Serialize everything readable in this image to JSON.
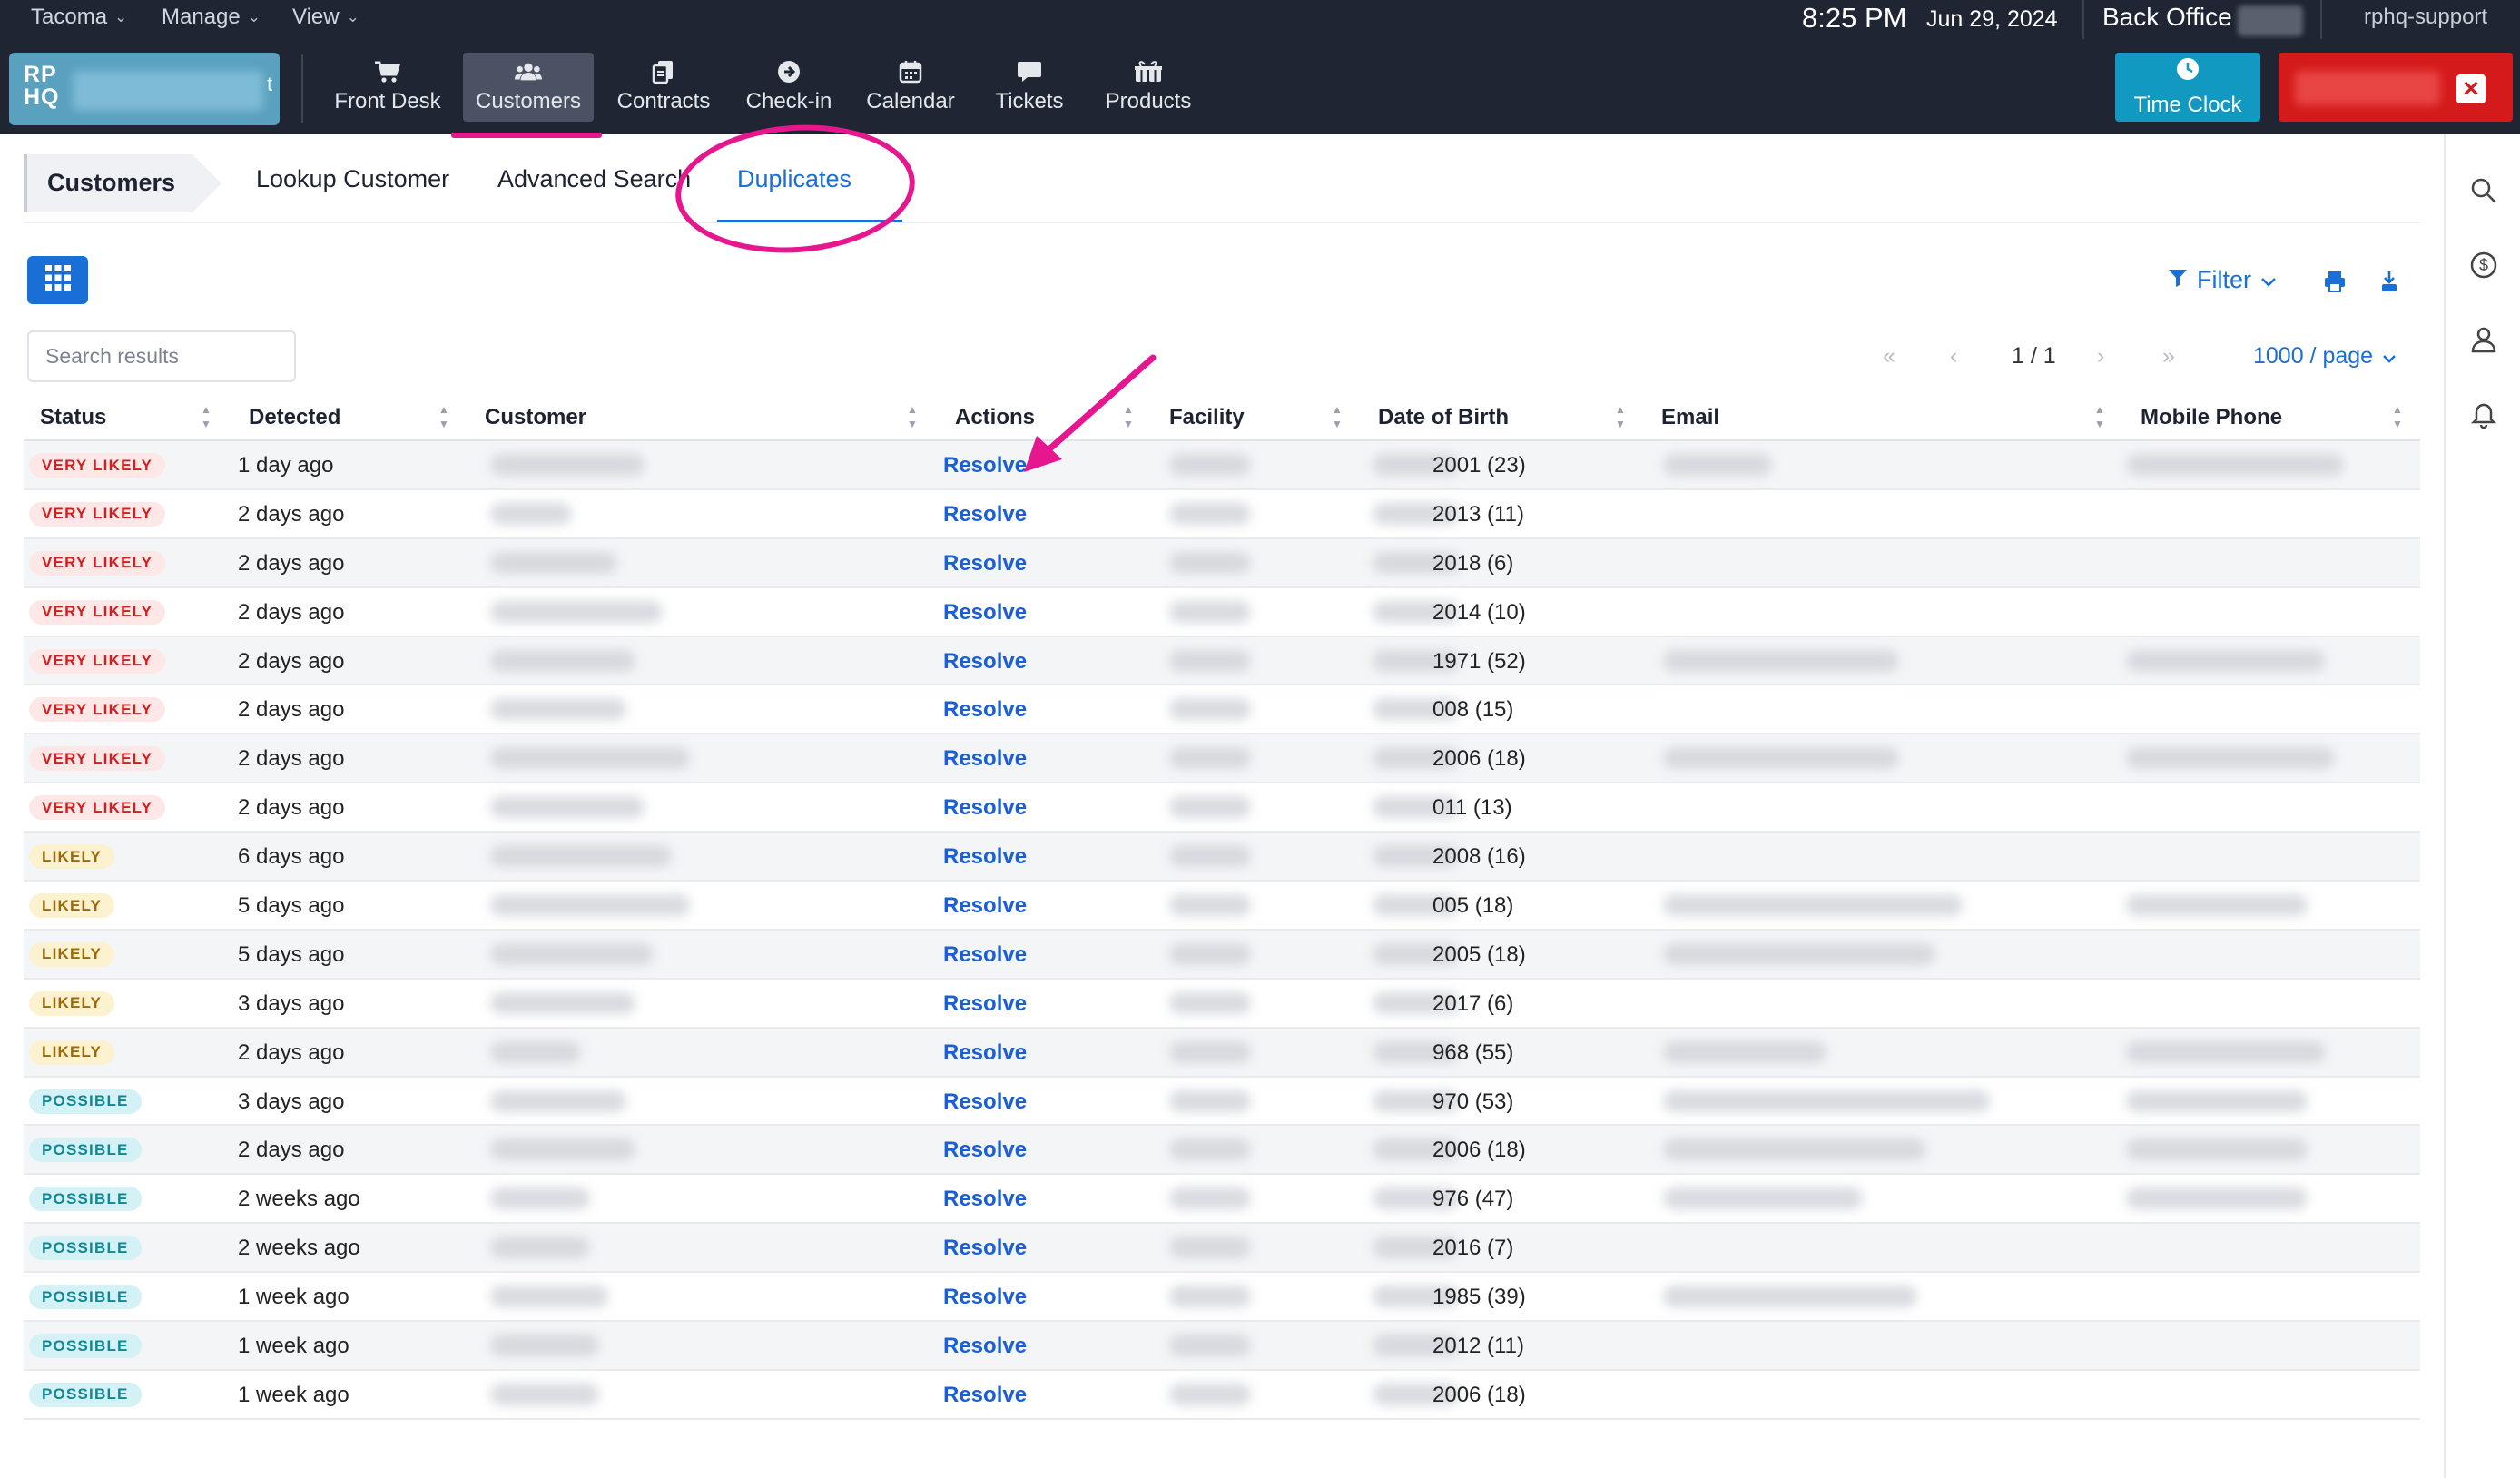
{
  "menubar": {
    "menus": [
      {
        "label": "Tacoma"
      },
      {
        "label": "Manage"
      },
      {
        "label": "View"
      }
    ],
    "time": "8:25 PM",
    "date": "Jun 29, 2024",
    "office": "Back Office",
    "user": "rphq-support"
  },
  "logo": {
    "mark_line1": "RP",
    "mark_line2": "HQ",
    "tail": "t"
  },
  "nav": {
    "items": [
      {
        "label": "Front Desk",
        "icon": "cart-icon"
      },
      {
        "label": "Customers",
        "icon": "users-icon"
      },
      {
        "label": "Contracts",
        "icon": "contracts-icon"
      },
      {
        "label": "Check-in",
        "icon": "checkin-icon"
      },
      {
        "label": "Calendar",
        "icon": "calendar-icon"
      },
      {
        "label": "Tickets",
        "icon": "chat-icon"
      },
      {
        "label": "Products",
        "icon": "gifts-icon"
      }
    ],
    "active": "Customers",
    "time_clock": "Time Clock"
  },
  "tabs": {
    "breadcrumb": "Customers",
    "items": [
      {
        "label": "Lookup Customer"
      },
      {
        "label": "Advanced Search"
      },
      {
        "label": "Duplicates"
      }
    ],
    "active": "Duplicates"
  },
  "toolbar": {
    "filter_label": "Filter",
    "search_placeholder": "Search results",
    "page_indicator": "1 / 1",
    "per_page": "1000 / page"
  },
  "table": {
    "columns": [
      "Status",
      "Detected",
      "Customer",
      "Actions",
      "Facility",
      "Date of Birth",
      "Email",
      "Mobile Phone"
    ],
    "action_label": "Resolve",
    "rows": [
      {
        "status": "VERY LIKELY",
        "level": "very",
        "detected": "1 day ago",
        "dob": "2001 (23)"
      },
      {
        "status": "VERY LIKELY",
        "level": "very",
        "detected": "2 days ago",
        "dob": "2013 (11)"
      },
      {
        "status": "VERY LIKELY",
        "level": "very",
        "detected": "2 days ago",
        "dob": "2018 (6)"
      },
      {
        "status": "VERY LIKELY",
        "level": "very",
        "detected": "2 days ago",
        "dob": "2014 (10)"
      },
      {
        "status": "VERY LIKELY",
        "level": "very",
        "detected": "2 days ago",
        "dob": "1971 (52)"
      },
      {
        "status": "VERY LIKELY",
        "level": "very",
        "detected": "2 days ago",
        "dob": "008 (15)"
      },
      {
        "status": "VERY LIKELY",
        "level": "very",
        "detected": "2 days ago",
        "dob": "2006 (18)"
      },
      {
        "status": "VERY LIKELY",
        "level": "very",
        "detected": "2 days ago",
        "dob": "011 (13)"
      },
      {
        "status": "LIKELY",
        "level": "likely",
        "detected": "6 days ago",
        "dob": "2008 (16)"
      },
      {
        "status": "LIKELY",
        "level": "likely",
        "detected": "5 days ago",
        "dob": "005 (18)"
      },
      {
        "status": "LIKELY",
        "level": "likely",
        "detected": "5 days ago",
        "dob": "2005 (18)"
      },
      {
        "status": "LIKELY",
        "level": "likely",
        "detected": "3 days ago",
        "dob": "2017 (6)"
      },
      {
        "status": "LIKELY",
        "level": "likely",
        "detected": "2 days ago",
        "dob": "968 (55)"
      },
      {
        "status": "POSSIBLE",
        "level": "possible",
        "detected": "3 days ago",
        "dob": "970 (53)"
      },
      {
        "status": "POSSIBLE",
        "level": "possible",
        "detected": "2 days ago",
        "dob": "2006 (18)"
      },
      {
        "status": "POSSIBLE",
        "level": "possible",
        "detected": "2 weeks ago",
        "dob": "976 (47)"
      },
      {
        "status": "POSSIBLE",
        "level": "possible",
        "detected": "2 weeks ago",
        "dob": "2016 (7)"
      },
      {
        "status": "POSSIBLE",
        "level": "possible",
        "detected": "1 week ago",
        "dob": "1985 (39)"
      },
      {
        "status": "POSSIBLE",
        "level": "possible",
        "detected": "1 week ago",
        "dob": "2012 (11)"
      },
      {
        "status": "POSSIBLE",
        "level": "possible",
        "detected": "1 week ago",
        "dob": "2006 (18)"
      }
    ]
  },
  "colors": {
    "accent": "#1a6fd6",
    "annotation": "#e6168f",
    "nav_bg": "#1f2532",
    "time_clock": "#1199c1",
    "alert": "#d41a1a",
    "very_likely": "#d11f1f",
    "likely": "#9b6a07",
    "possible": "#108795"
  }
}
